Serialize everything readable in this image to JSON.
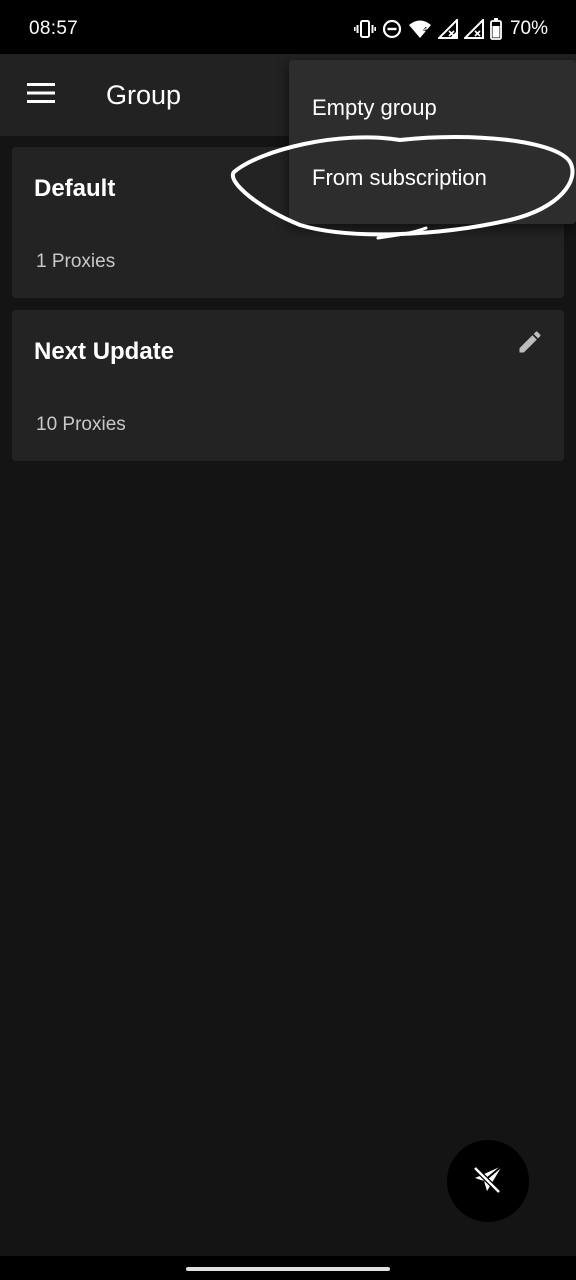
{
  "status_bar": {
    "time": "08:57",
    "battery_percent": "70%",
    "icons": [
      "vibrate-icon",
      "do-not-disturb-icon",
      "wifi-icon",
      "signal-icon",
      "signal-icon",
      "battery-icon"
    ]
  },
  "app_bar": {
    "title": "Group",
    "menu_icon": "hamburger-menu-icon"
  },
  "groups": [
    {
      "name": "Default",
      "proxies": "1 Proxies"
    },
    {
      "name": "Next Update",
      "proxies": "10 Proxies",
      "edit_icon": "pencil-icon"
    }
  ],
  "popup_menu": {
    "items": [
      {
        "label": "Empty group"
      },
      {
        "label": "From subscription"
      }
    ]
  },
  "fab": {
    "icon": "paper-plane-off-icon"
  },
  "colors": {
    "background": "#141414",
    "app_bar": "#222222",
    "card": "#232323",
    "menu": "#2d2d2d",
    "annotation": "#ffffff"
  }
}
